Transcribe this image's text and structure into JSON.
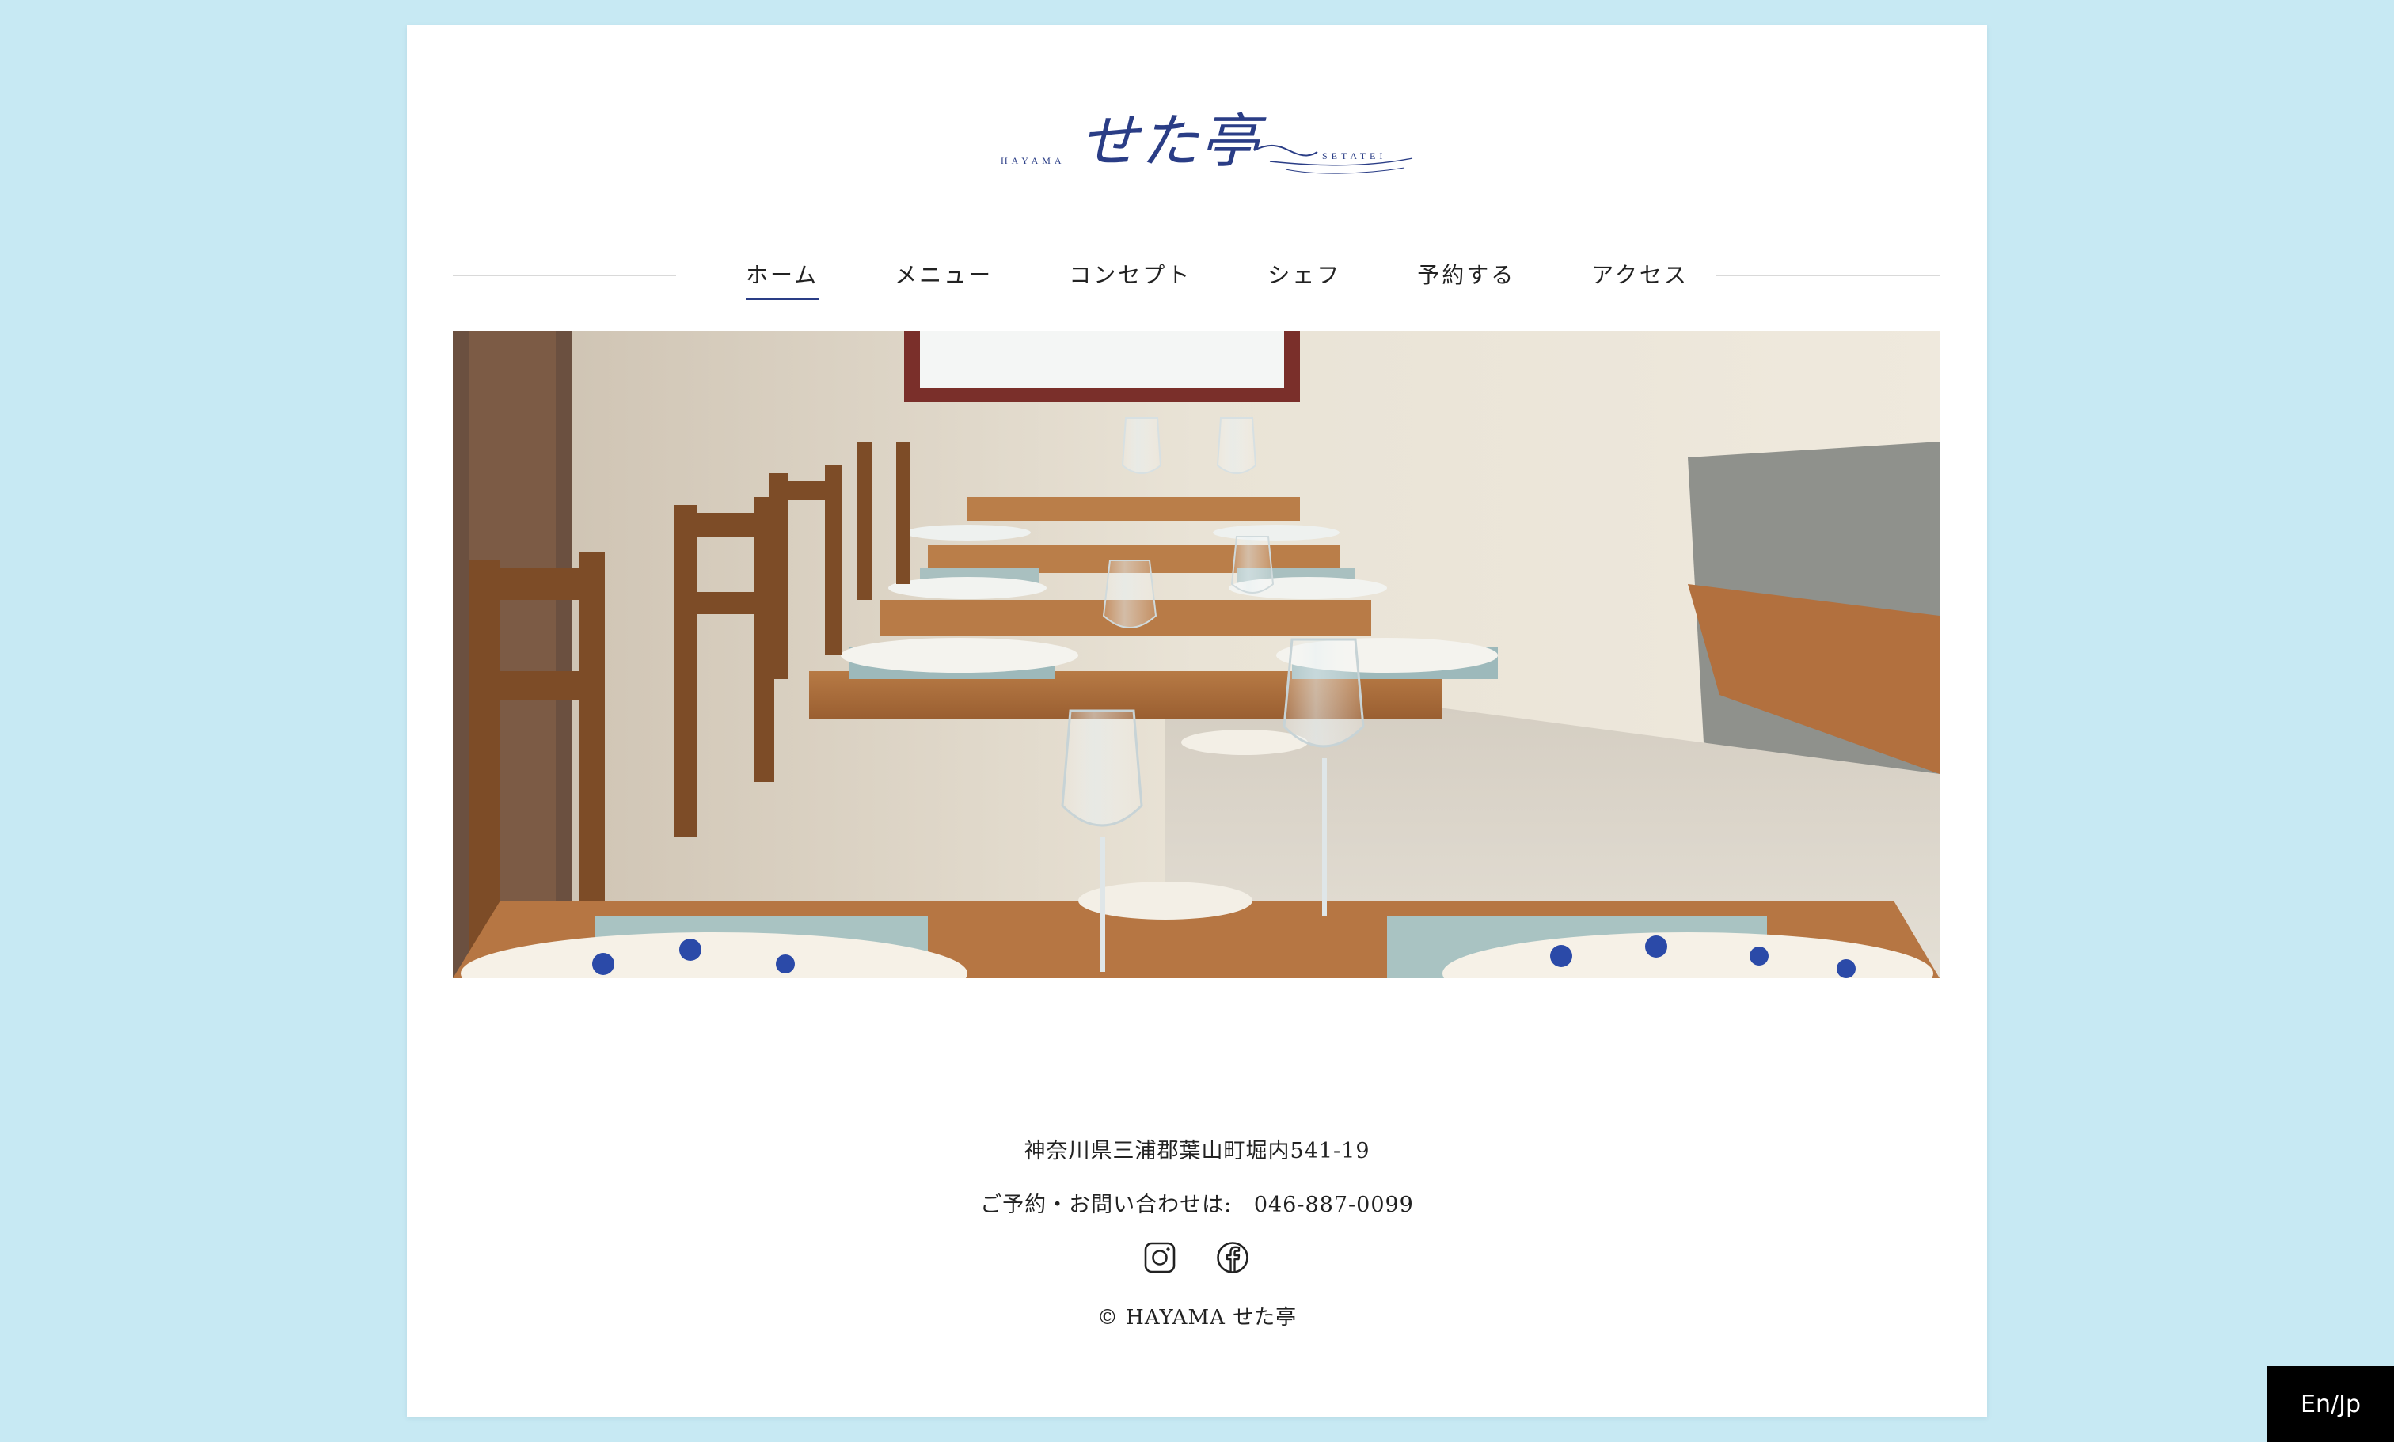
{
  "brand": {
    "left_text": "HAYAMA",
    "name": "せた亭",
    "right_text": "SETATEI",
    "color": "#2a3d86"
  },
  "nav": {
    "items": [
      {
        "label": "ホーム",
        "active": true
      },
      {
        "label": "メニュー",
        "active": false
      },
      {
        "label": "コンセプト",
        "active": false
      },
      {
        "label": "シェフ",
        "active": false
      },
      {
        "label": "予約する",
        "active": false
      },
      {
        "label": "アクセス",
        "active": false
      }
    ]
  },
  "hero": {
    "alt": "せた亭 dining room with set tables"
  },
  "footer": {
    "address": "神奈川県三浦郡葉山町堀内541-19",
    "reserve_label": "ご予約・お問い合わせは:",
    "phone": "046-887-0099",
    "social": [
      {
        "icon": "instagram-icon"
      },
      {
        "icon": "facebook-icon"
      }
    ],
    "copyright": "© HAYAMA せた亭"
  },
  "lang_toggle": "En/Jp",
  "colors": {
    "background": "#c7e9f3",
    "card": "#ffffff",
    "accent": "#2a3d86"
  }
}
